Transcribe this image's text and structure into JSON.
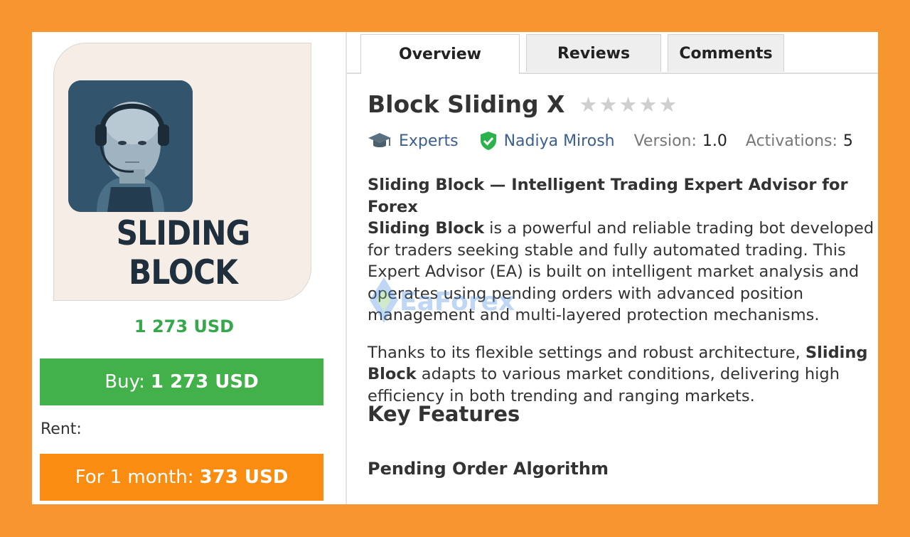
{
  "product": {
    "logo_text": "SLIDING BLOCK",
    "price": "1 273 USD",
    "buy": {
      "label": "Buy:",
      "amount": "1 273 USD"
    },
    "rent_label": "Rent:",
    "rent": {
      "label": "For 1 month:",
      "amount": "373 USD"
    },
    "rating_stars": 0,
    "rating_max": 5
  },
  "tabs": [
    "Overview",
    "Reviews",
    "Comments"
  ],
  "active_tab": "Overview",
  "header": {
    "title": "Block Sliding X",
    "category": "Experts",
    "author": "Nadiya Mirosh",
    "version_label": "Version:",
    "version": "1.0",
    "activations_label": "Activations:",
    "activations": "5"
  },
  "description": {
    "p1_heading": "Sliding Block — Intelligent Trading Expert Advisor for Forex",
    "p1_bold": "Sliding Block",
    "p1_text": " is a powerful and reliable trading bot developed for traders seeking stable and fully automated trading. This Expert Advisor (EA) is built on intelligent market analysis and operates using pending orders with advanced position management and multi-layered protection mechanisms.",
    "p2_text_a": "Thanks to its flexible settings and robust architecture, ",
    "p2_bold": "Sliding Block",
    "p2_text_b": " adapts to various market conditions, delivering high efficiency in both trending and ranging markets.",
    "h2": "Key Features",
    "h3": "Pending Order Algorithm"
  },
  "watermark": "EaForex",
  "colors": {
    "background": "#f7962f",
    "price_green": "#34a84a",
    "buy_button": "#43b14a",
    "rent_button": "#fa8c12",
    "link": "#3a5f90"
  }
}
